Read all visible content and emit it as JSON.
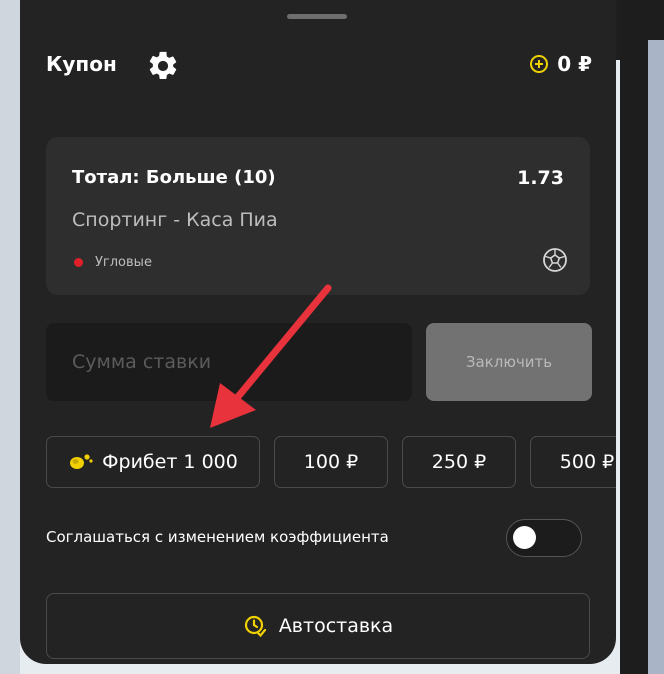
{
  "coupon": {
    "title": "Купон",
    "balance": "0 ₽"
  },
  "bet": {
    "title": "Тотал: Больше (10)",
    "odds": "1.73",
    "match": "Спортинг - Каса Пиа",
    "market": "Угловые"
  },
  "stake": {
    "placeholder": "Сумма ставки",
    "place_label": "Заключить"
  },
  "chips": [
    {
      "label": "Фрибет 1 000"
    },
    {
      "label": "100 ₽"
    },
    {
      "label": "250 ₽"
    },
    {
      "label": "500 ₽"
    }
  ],
  "agree": {
    "label": "Соглашаться с изменением коэффициента",
    "enabled": false
  },
  "autobet": {
    "label": "Автоставка"
  },
  "icons": {
    "settings": "gear-icon",
    "balance": "coin-plus-icon",
    "sport": "soccer-ball-icon",
    "freebet": "freebet-coins-icon",
    "autobet": "clock-check-icon",
    "annotation": "red-arrow-annotation"
  },
  "colors": {
    "background": "#232323",
    "card": "#2e2e2e",
    "accent": "#f0d000",
    "live_dot": "#e0202a",
    "annotation_arrow": "#e8323c",
    "disabled_button": "#727272"
  }
}
